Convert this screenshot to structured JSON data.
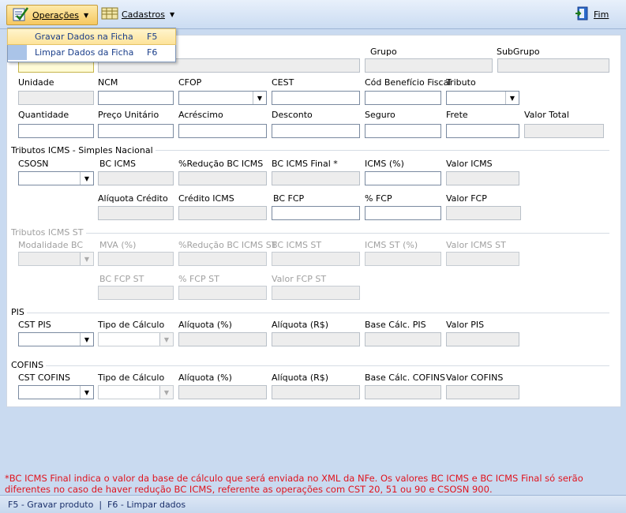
{
  "toolbar": {
    "operacoes_label": "Operações",
    "cadastros_label": "Cadastros",
    "fim_label": "Fim"
  },
  "menu": {
    "items": [
      {
        "label": "Gravar Dados na Ficha",
        "shortcut": "F5"
      },
      {
        "label": "Limpar Dados da Ficha",
        "shortcut": "F6"
      }
    ]
  },
  "produto": {
    "grupo": "Grupo",
    "subgrupo": "SubGrupo",
    "unidade": "Unidade",
    "ncm": "NCM",
    "cfop": "CFOP",
    "cest": "CEST",
    "cod_beneficio": "Cód Benefício Fiscal",
    "tributo": "Tributo",
    "quantidade": "Quantidade",
    "preco_unitario": "Preço Unitário",
    "acrescimo": "Acréscimo",
    "desconto": "Desconto",
    "seguro": "Seguro",
    "frete": "Frete",
    "valor_total": "Valor Total"
  },
  "icms_sn": {
    "title": "Tributos ICMS - Simples Nacional",
    "csosn": "CSOSN",
    "bc_icms": "BC ICMS",
    "reducao_bc": "%Redução BC ICMS",
    "bc_icms_final": "BC ICMS Final *",
    "icms_pct": "ICMS (%)",
    "valor_icms": "Valor ICMS",
    "aliquota_credito": "Alíquota Crédito",
    "credito_icms": "Crédito ICMS",
    "bc_fcp": "BC FCP",
    "pct_fcp": "% FCP",
    "valor_fcp": "Valor FCP"
  },
  "icms_st": {
    "title": "Tributos ICMS ST",
    "modalidade_bc": "Modalidade BC",
    "mva": "MVA (%)",
    "reducao_bc_st": "%Redução BC ICMS ST",
    "bc_icms_st": "BC ICMS ST",
    "icms_st_pct": "ICMS ST (%)",
    "valor_icms_st": "Valor ICMS ST",
    "bc_fcp_st": "BC FCP ST",
    "pct_fcp_st": "% FCP ST",
    "valor_fcp_st": "Valor FCP ST"
  },
  "pis": {
    "title": "PIS",
    "cst": "CST PIS",
    "tipo_calculo": "Tipo de Cálculo",
    "aliquota_pct": "Alíquota (%)",
    "aliquota_rs": "Alíquota (R$)",
    "base_calc": "Base Cálc. PIS",
    "valor": "Valor PIS"
  },
  "cofins": {
    "title": "COFINS",
    "cst": "CST COFINS",
    "tipo_calculo": "Tipo de Cálculo",
    "aliquota_pct": "Alíquota (%)",
    "aliquota_rs": "Alíquota (R$)",
    "base_calc": "Base Cálc. COFINS",
    "valor": "Valor COFINS"
  },
  "note": "*BC ICMS Final indica o valor da base de cálculo que será enviada no XML da NFe. Os valores BC ICMS e BC ICMS Final só serão diferentes no caso de haver redução BC ICMS, referente as operações com CST 20, 51 ou 90 e CSOSN 900.",
  "status": "F5 - Gravar produto  |  F6 - Limpar dados",
  "colors": {
    "note_red": "#e0141e",
    "toolbar_bg": "#cbdcf2",
    "menu_highlight": "#fde39a"
  }
}
